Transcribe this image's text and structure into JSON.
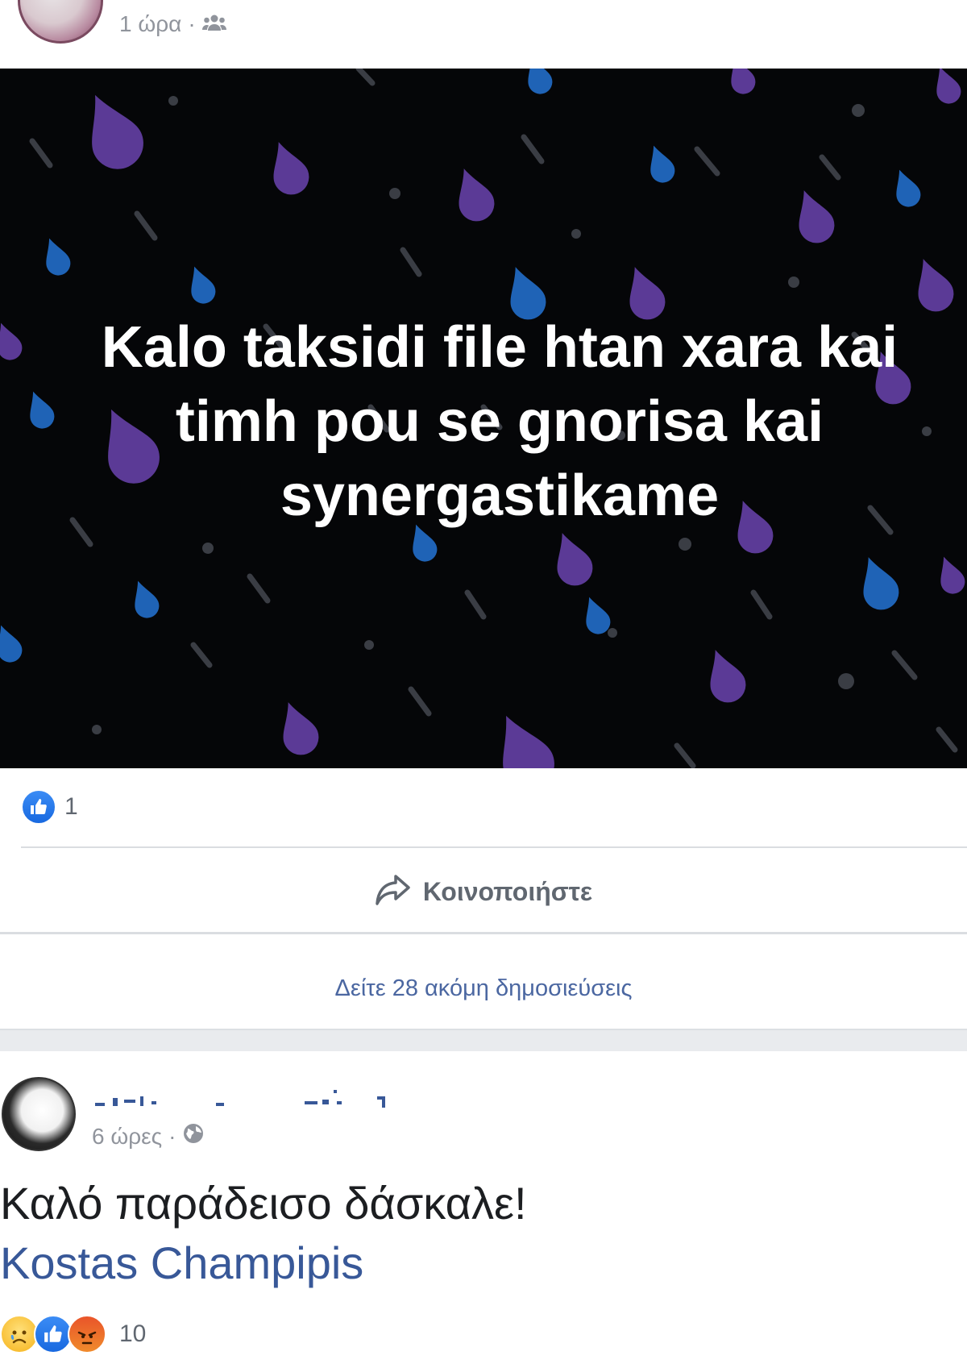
{
  "top_post": {
    "time": "1 ώρα",
    "separator": "·",
    "audience_icon": "group-icon",
    "image_text": "Kalo taksidi file htan xara kai timh pou se gnorisa kai synergastikame",
    "like_count": "1",
    "share_label": "Κοινοποιήστε"
  },
  "see_more": "Δείτε 28 ακόμη δημοσιεύσεις",
  "second_post": {
    "time": "6 ώρες",
    "separator": "·",
    "audience_icon": "globe-icon",
    "text": "Καλό παράδεισο δάσκαλε!",
    "mention": "Kostas Champipis",
    "reaction_count": "10",
    "reaction_icons": [
      "sad-icon",
      "like-icon",
      "angry-icon"
    ]
  },
  "colors": {
    "link": "#385898",
    "meta": "#90949c",
    "image_bg": "#050608",
    "drop_purple": "#5b3a96",
    "drop_blue": "#1f63b6",
    "drop_gray": "#3a3d44"
  }
}
